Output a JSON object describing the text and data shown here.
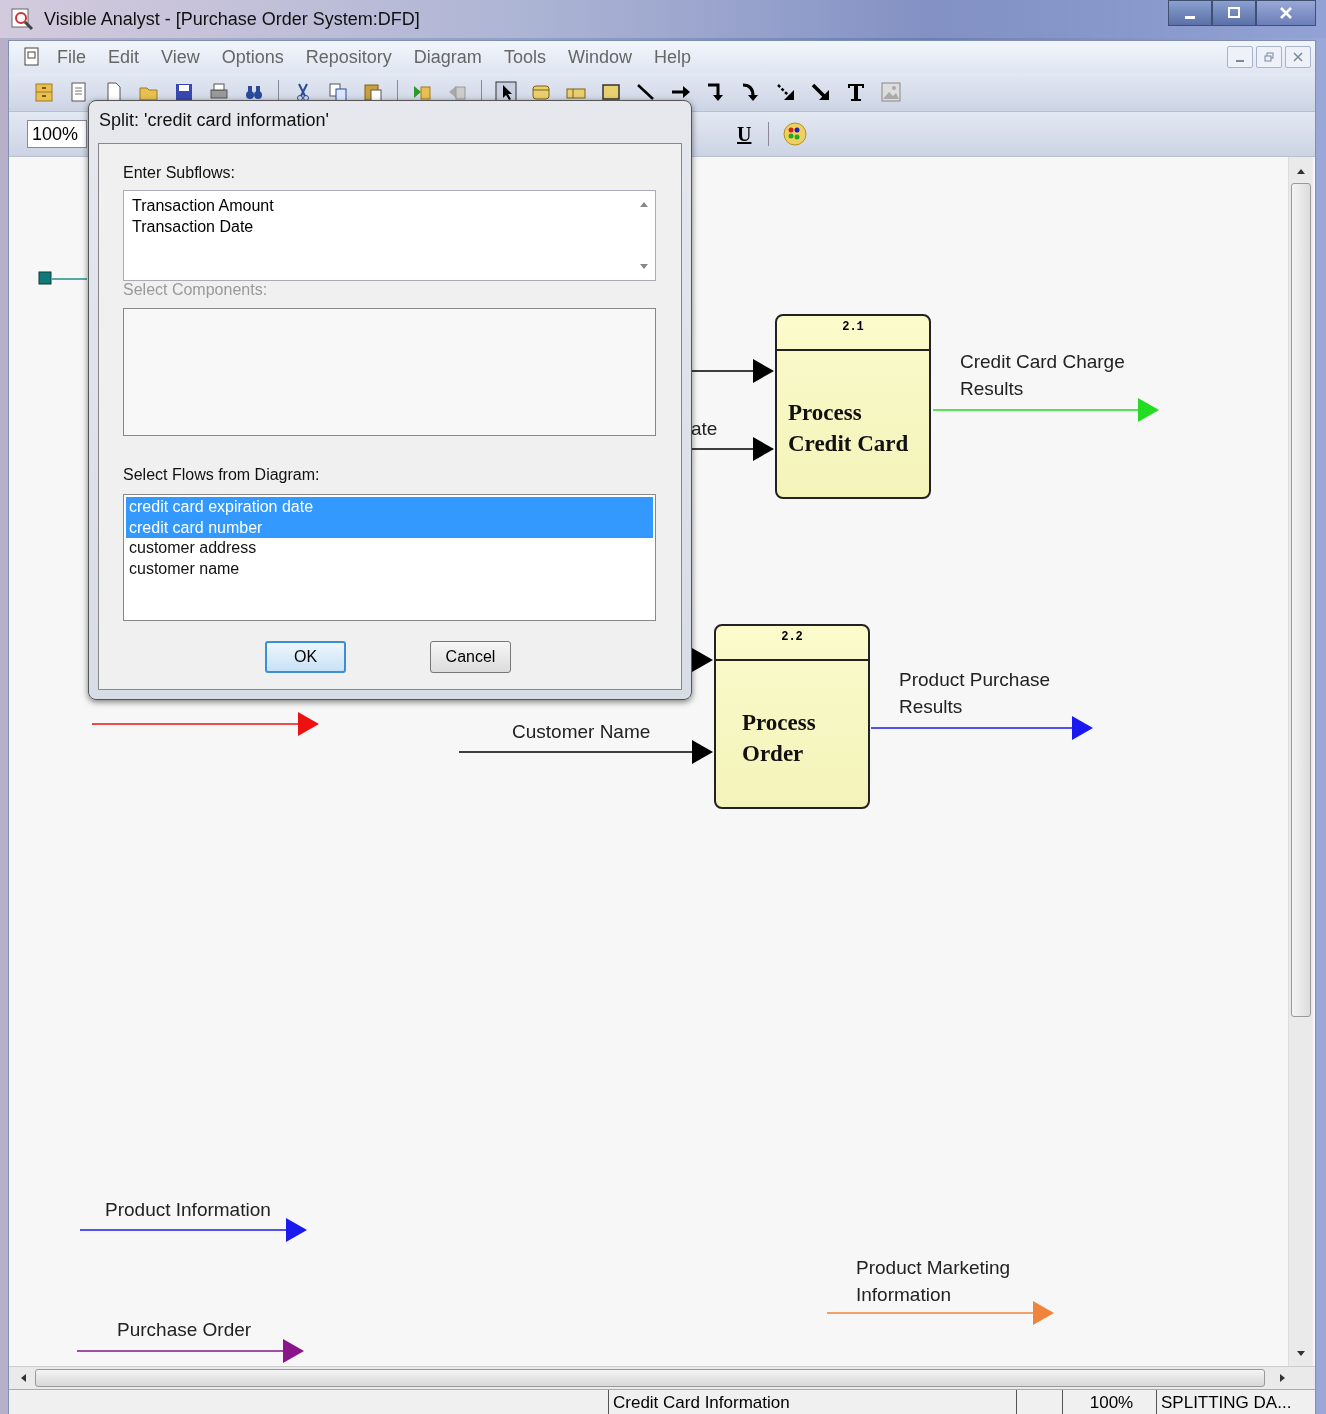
{
  "window": {
    "title": "Visible Analyst - [Purchase Order System:DFD]"
  },
  "menu": [
    "File",
    "Edit",
    "View",
    "Options",
    "Repository",
    "Diagram",
    "Tools",
    "Window",
    "Help"
  ],
  "toolbar": {
    "zoom": "100%",
    "underline": "U"
  },
  "diagram": {
    "processes": [
      {
        "number": "2.1",
        "name": "Process Credit Card"
      },
      {
        "number": "2.2",
        "name": "Process Order"
      }
    ],
    "flows": [
      {
        "color": "#000000"
      },
      {
        "label": "ate",
        "color": "#000000"
      },
      {
        "label": "Credit Card Charge Results",
        "color": "#22dd22"
      },
      {
        "color": "#000000"
      },
      {
        "label": "Product Purchase Results",
        "color": "#1a1aee"
      },
      {
        "color": "#ee1111"
      },
      {
        "label": "Customer Name",
        "color": "#000000"
      },
      {
        "label": "Product Information",
        "color": "#1a1aee"
      },
      {
        "label": "Product Marketing Information",
        "color": "#f0843c"
      },
      {
        "label": "Purchase Order",
        "color": "#8a148a"
      }
    ]
  },
  "dialog": {
    "title": "Split: 'credit card information'",
    "subflows_label": "Enter Subflows:",
    "subflows": "Transaction Amount\nTransaction Date",
    "components_label": "Select Components:",
    "components_disabled": true,
    "flows_label": "Select Flows from Diagram:",
    "flow_items": [
      {
        "label": "credit card expiration date",
        "selected": true
      },
      {
        "label": "credit card number",
        "selected": true
      },
      {
        "label": "customer address",
        "selected": false
      },
      {
        "label": "customer name",
        "selected": false
      }
    ],
    "buttons": [
      {
        "label": "OK",
        "default": true
      },
      {
        "label": "Cancel",
        "default": false
      }
    ]
  },
  "status_bar": [
    "Credit Card Information",
    "100%",
    "SPLITTING DA..."
  ]
}
